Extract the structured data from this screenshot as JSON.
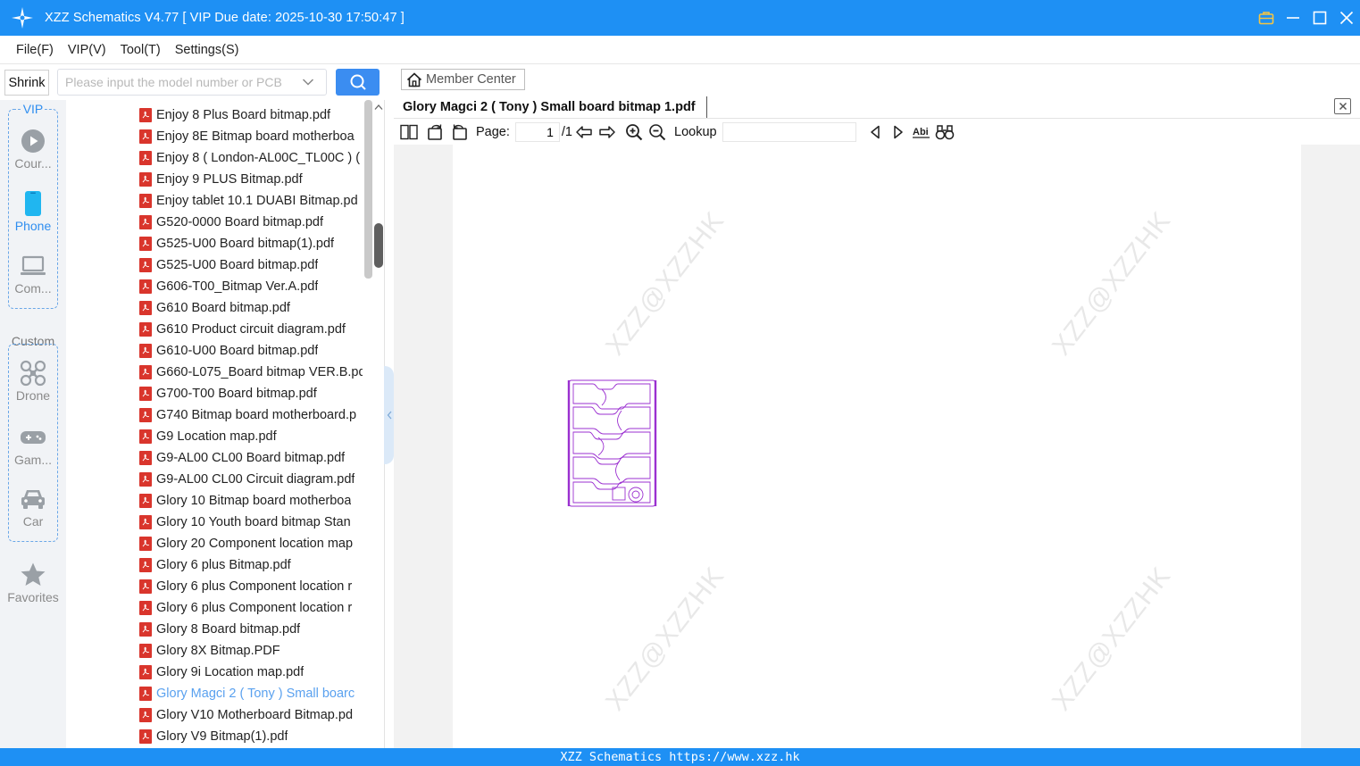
{
  "app": {
    "title": "XZZ Schematics V4.77 [ VIP Due date: 2025-10-30 17:50:47 ]",
    "footer": "XZZ Schematics https://www.xzz.hk"
  },
  "menu": {
    "items": [
      "File(F)",
      "VIP(V)",
      "Tool(T)",
      "Settings(S)"
    ]
  },
  "search": {
    "shrink_label": "Shrink",
    "placeholder": "Please input the model number or PCB",
    "value": ""
  },
  "categories": {
    "vip_label": "VIP",
    "vip_items": [
      {
        "label": "Cour...",
        "icon": "play-icon"
      },
      {
        "label": "Phone",
        "icon": "phone-icon",
        "active": true
      },
      {
        "label": "Com...",
        "icon": "laptop-icon"
      }
    ],
    "custom_label": "Custom",
    "custom_items": [
      {
        "label": "Drone",
        "icon": "drone-icon"
      },
      {
        "label": "Gam...",
        "icon": "gamepad-icon"
      },
      {
        "label": "Car",
        "icon": "car-icon"
      }
    ],
    "favorites_label": "Favorites"
  },
  "files": [
    "Enjoy 8 Plus Board bitmap.pdf",
    "Enjoy 8E Bitmap board motherboa",
    "Enjoy 8 ( London-AL00C_TL00C ) (",
    "Enjoy 9 PLUS Bitmap.pdf",
    "Enjoy tablet 10.1 DUABI Bitmap.pd",
    "G520-0000 Board bitmap.pdf",
    "G525-U00 Board bitmap(1).pdf",
    "G525-U00 Board bitmap.pdf",
    "G606-T00_Bitmap Ver.A.pdf",
    "G610 Board bitmap.pdf",
    "G610 Product circuit diagram.pdf",
    "G610-U00 Board bitmap.pdf",
    "G660-L075_Board bitmap VER.B.pd",
    "G700-T00 Board bitmap.pdf",
    "G740 Bitmap board motherboard.p",
    "G9 Location map.pdf",
    "G9-AL00 CL00 Board bitmap.pdf",
    "G9-AL00 CL00 Circuit diagram.pdf",
    "Glory 10 Bitmap board motherboa",
    "Glory 10 Youth board bitmap Stan",
    "Glory 20 Component location map",
    "Glory 6 plus Bitmap.pdf",
    "Glory 6 plus Component location r",
    "Glory 6 plus Component location r",
    "Glory 8 Board bitmap.pdf",
    "Glory 8X Bitmap.PDF",
    "Glory 9i Location map.pdf",
    "Glory Magci 2 ( Tony ) Small boarc",
    "Glory V10 Motherboard Bitmap.pd",
    "Glory V9 Bitmap(1).pdf"
  ],
  "selected_file_index": 27,
  "viewer": {
    "member_center_label": "Member Center",
    "tab_title": "Glory Magci 2 ( Tony ) Small board bitmap 1.pdf",
    "page_label": "Page:",
    "page_current": "1",
    "page_total": "/1",
    "lookup_label": "Lookup",
    "lookup_value": "",
    "watermark": "XZZ@XZZHK"
  },
  "colors": {
    "accent": "#1e90f4",
    "search_button": "#3b8df1",
    "pdf_icon": "#d9352c",
    "selected_text": "#5aa1ef",
    "board_outline": "#9b30d0"
  }
}
